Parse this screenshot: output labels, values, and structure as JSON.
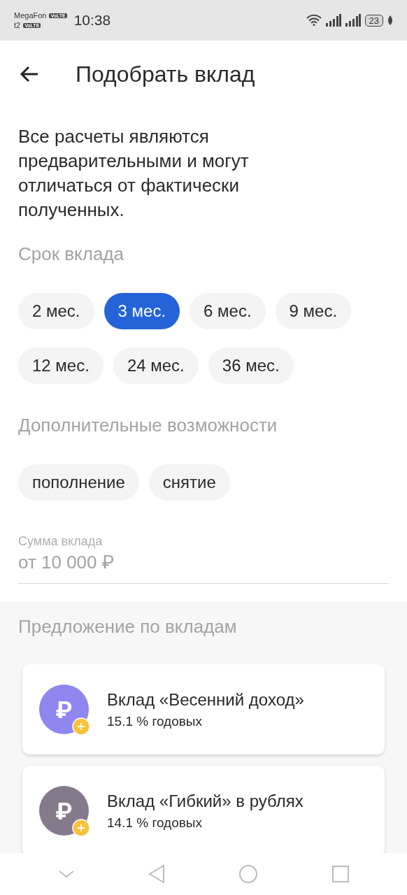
{
  "status_bar": {
    "carrier_1": "MegaFon",
    "carrier_1_badge": "VoLTE",
    "carrier_2": "t2",
    "carrier_2_badge": "VoLTE",
    "time": "10:38",
    "battery": "23"
  },
  "header": {
    "title": "Подобрать вклад"
  },
  "disclaimer": "Все расчеты являются предварительными и могут отличаться от фактически полученных.",
  "term": {
    "label": "Срок вклада",
    "options": [
      {
        "label": "2 мес.",
        "selected": false
      },
      {
        "label": "3 мес.",
        "selected": true
      },
      {
        "label": "6 мес.",
        "selected": false
      },
      {
        "label": "9 мес.",
        "selected": false
      },
      {
        "label": "12 мес.",
        "selected": false
      },
      {
        "label": "24 мес.",
        "selected": false
      },
      {
        "label": "36 мес.",
        "selected": false
      }
    ]
  },
  "features": {
    "label": "Дополнительные возможности",
    "options": [
      {
        "label": "пополнение",
        "selected": false
      },
      {
        "label": "снятие",
        "selected": false
      }
    ]
  },
  "amount": {
    "label": "Сумма вклада",
    "placeholder": "от 10 000 ₽"
  },
  "offers": {
    "title": "Предложение по вкладам",
    "items": [
      {
        "name": "Вклад «Весенний доход»",
        "rate": "15.1 % годовых",
        "symbol": "₽",
        "color": "#8f86f0"
      },
      {
        "name": "Вклад «Гибкий» в рублях",
        "rate": "14.1 % годовых",
        "symbol": "₽",
        "color": "#857a8c"
      }
    ]
  }
}
